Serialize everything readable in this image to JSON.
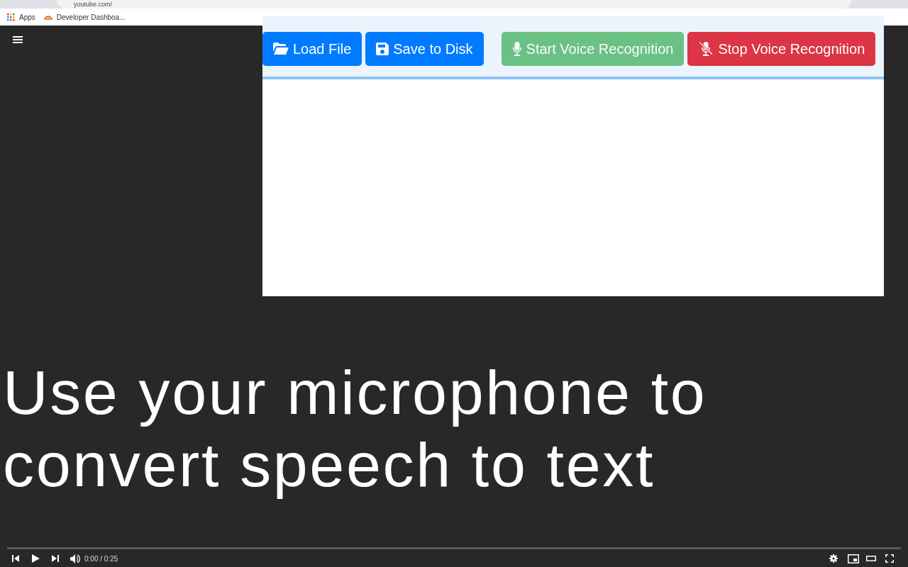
{
  "browser": {
    "address": "youtube.com/",
    "bookmarks": [
      {
        "label": "Apps",
        "kind": "apps"
      },
      {
        "label": "Developer Dashboa...",
        "kind": "site"
      }
    ]
  },
  "toolbar": {
    "buttons": [
      {
        "label": "Load File",
        "kind": "load",
        "disabled": false
      },
      {
        "label": "Save to Disk",
        "kind": "save",
        "disabled": false
      },
      {
        "label": "Start Voice Recognition",
        "kind": "start",
        "disabled": true
      },
      {
        "label": "Stop Voice Recognition",
        "kind": "stop",
        "disabled": false
      }
    ]
  },
  "caption": "Use your microphone to convert speech to text",
  "player": {
    "time": "0:00 / 0:25"
  }
}
